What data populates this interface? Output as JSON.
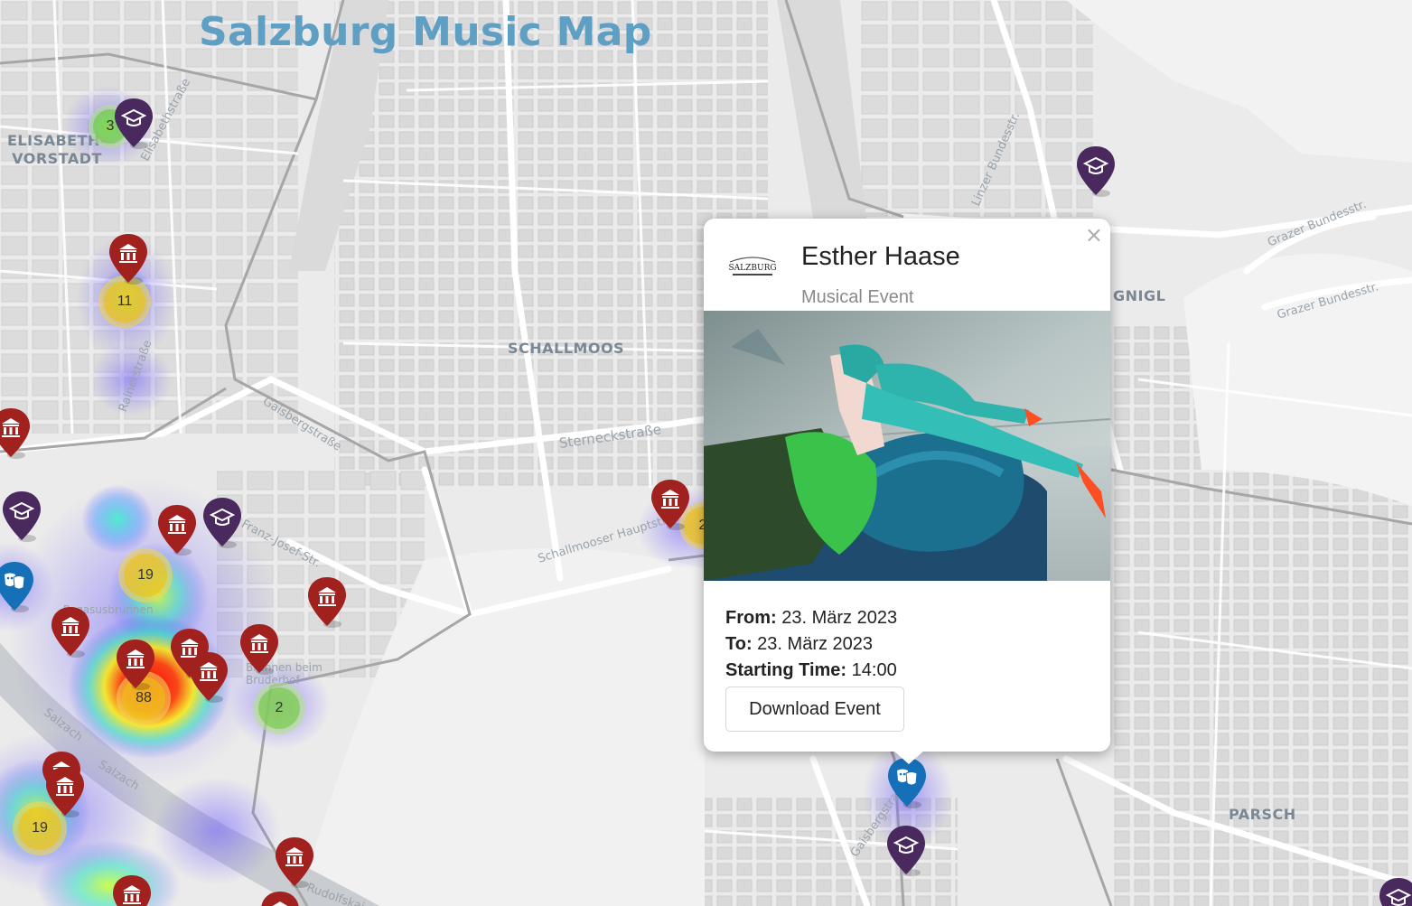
{
  "title": "Salzburg Music Map",
  "districts": {
    "elisabeth_vorstadt": "ELISABETH-\nVORSTADT",
    "schallmoos": "SCHALLMOOS",
    "gnigl": "GNIGL",
    "parsch": "PARSCH"
  },
  "streets": {
    "elisabethstrasse": "Elisabethstraße",
    "rainerstrasse": "Rainerstraße",
    "gaisbergstrasse_top": "Gaisbergstraße",
    "sterneckstrasse": "Sterneckstraße",
    "schallmooser_hauptstrasse": "Schallmooser Hauptstr.",
    "franz_josef_strasse": "Franz-Josef-Str.",
    "linzer_bundesstrasse": "Linzer Bundesstr.",
    "grazer_bundesstrasse_1": "Grazer Bundesstr.",
    "grazer_bundesstrasse_2": "Grazer Bundesstr.",
    "salzach_1": "Salzach",
    "salzach_2": "Salzach",
    "rudolfskai": "Rudolfskai",
    "gaisbergstrasse_bottom": "Gaisbergstraße",
    "hagelsbrunnen": "Pegasusbrunnen",
    "bruderhof": "Brunnen beim Bruderhof"
  },
  "clusters": [
    {
      "id": "c3",
      "count": "3",
      "color": "green"
    },
    {
      "id": "c11",
      "count": "11",
      "color": "yellow"
    },
    {
      "id": "c19a",
      "count": "19",
      "color": "yellow"
    },
    {
      "id": "c88",
      "count": "88",
      "color": "yellow"
    },
    {
      "id": "c2a",
      "count": "2",
      "color": "green"
    },
    {
      "id": "c19b",
      "count": "19",
      "color": "yellow"
    },
    {
      "id": "c2b",
      "count": "2",
      "color": "yellow"
    }
  ],
  "marker_colors": {
    "museum": "#a1211f",
    "education": "#4a2a5e",
    "theatre": "#1670b8"
  },
  "popup": {
    "close": "×",
    "name": "Esther Haase",
    "type": "Musical Event",
    "logo_text": "SALZBURG",
    "from_label": "From:",
    "from_value": "23. März 2023",
    "to_label": "To:",
    "to_value": "23. März 2023",
    "start_label": "Starting Time:",
    "start_value": "14:00",
    "download_label": "Download Event"
  }
}
